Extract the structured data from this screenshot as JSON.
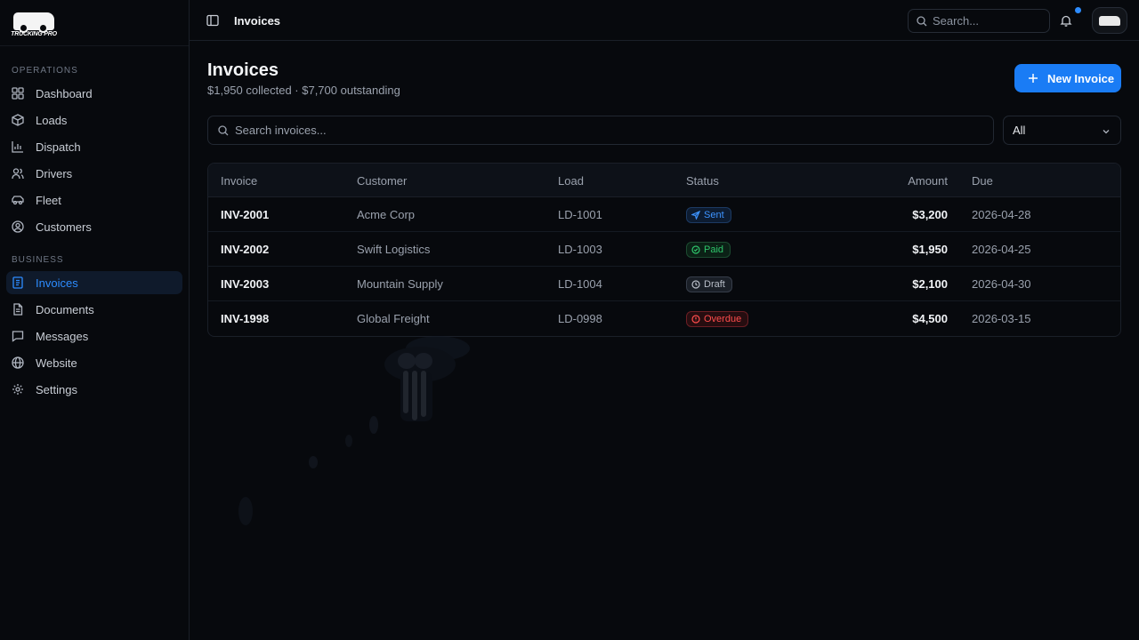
{
  "brand": {
    "logo_text": "TRUCKING PRO"
  },
  "sidebar": {
    "sections": [
      {
        "label": "OPERATIONS"
      },
      {
        "label": "BUSINESS"
      }
    ],
    "operations": [
      {
        "label": "Dashboard",
        "icon": "dashboard-icon"
      },
      {
        "label": "Loads",
        "icon": "box-icon"
      },
      {
        "label": "Dispatch",
        "icon": "chart-icon"
      },
      {
        "label": "Drivers",
        "icon": "users-icon"
      },
      {
        "label": "Fleet",
        "icon": "truck-icon"
      },
      {
        "label": "Customers",
        "icon": "user-circle-icon"
      }
    ],
    "business": [
      {
        "label": "Invoices",
        "icon": "invoice-icon",
        "active": true
      },
      {
        "label": "Documents",
        "icon": "document-icon"
      },
      {
        "label": "Messages",
        "icon": "message-icon"
      },
      {
        "label": "Website",
        "icon": "globe-icon"
      },
      {
        "label": "Settings",
        "icon": "gear-icon"
      }
    ]
  },
  "topbar": {
    "breadcrumb": "Invoices",
    "search_placeholder": "Search..."
  },
  "main": {
    "title": "Invoices",
    "subtitle": "$1,950 collected · $7,700 outstanding",
    "new_button": "New Invoice",
    "search_placeholder": "Search invoices...",
    "filter_value": "All"
  },
  "table": {
    "columns": [
      "Invoice",
      "Customer",
      "Load",
      "Status",
      "Amount",
      "Due"
    ],
    "rows": [
      {
        "invoice": "INV-2001",
        "customer": "Acme Corp",
        "load": "LD-1001",
        "status": "Sent",
        "amount": "$3,200",
        "due": "2026-04-28"
      },
      {
        "invoice": "INV-2002",
        "customer": "Swift Logistics",
        "load": "LD-1003",
        "status": "Paid",
        "amount": "$1,950",
        "due": "2026-04-25"
      },
      {
        "invoice": "INV-2003",
        "customer": "Mountain Supply",
        "load": "LD-1004",
        "status": "Draft",
        "amount": "$2,100",
        "due": "2026-04-30"
      },
      {
        "invoice": "INV-1998",
        "customer": "Global Freight",
        "load": "LD-0998",
        "status": "Overdue",
        "amount": "$4,500",
        "due": "2026-03-15"
      }
    ]
  },
  "colors": {
    "accent": "#1a7cf5",
    "background": "#07090d",
    "sent": "#3d93ff",
    "paid": "#2fc46b",
    "draft": "#b8bec8",
    "overdue": "#ff4d4d"
  }
}
